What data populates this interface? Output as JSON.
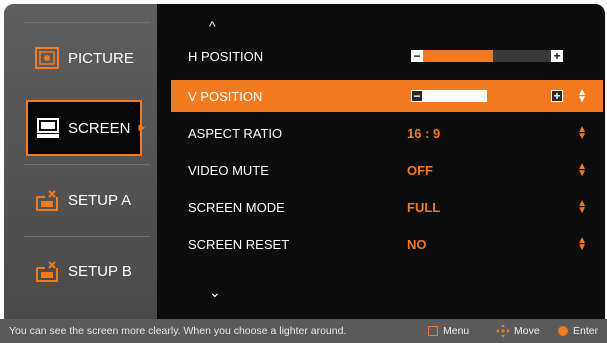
{
  "sidebar": {
    "items": [
      {
        "label": "PICTURE",
        "icon": "picture-icon"
      },
      {
        "label": "SCREEN",
        "icon": "screen-icon",
        "active": true,
        "arrow": "►"
      },
      {
        "label": "SETUP A",
        "icon": "setup-icon"
      },
      {
        "label": "SETUP B",
        "icon": "setup-icon"
      }
    ]
  },
  "menu": {
    "scroll_up": "^",
    "scroll_down": "⌄",
    "rows": [
      {
        "label": "H POSITION",
        "slider_level": 0.55
      },
      {
        "label": "V POSITION",
        "slider_level": 0.5,
        "selected": true
      },
      {
        "label": "ASPECT RATIO",
        "value": "16 : 9"
      },
      {
        "label": "VIDEO MUTE",
        "value": "OFF"
      },
      {
        "label": "SCREEN MODE",
        "value": "FULL"
      },
      {
        "label": "SCREEN RESET",
        "value": "NO"
      }
    ],
    "slider_minus": "−",
    "slider_plus": "+"
  },
  "helpbar": {
    "message": "You can see the screen more clearly.  When you choose a lighter around.",
    "menu_label": "Menu",
    "move_label": "Move",
    "enter_label": "Enter"
  },
  "colors": {
    "accent": "#f47a20",
    "sidebar": "#555555",
    "background": "#0c0c0c"
  }
}
